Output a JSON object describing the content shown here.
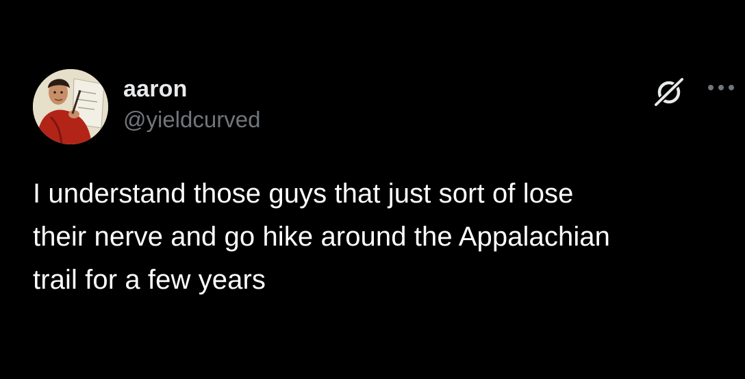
{
  "tweet": {
    "author": {
      "display_name": "aaron",
      "handle": "@yieldcurved"
    },
    "text": "I understand those guys that just sort of lose\ntheir nerve and go hike around the Appalachian\ntrail for a few years",
    "icons": {
      "avatar": "profile-photo",
      "grok": "grok-icon",
      "more": "more-options-icon"
    }
  },
  "colors": {
    "background": "#000000",
    "primary_text": "#e7e9ea",
    "secondary_text": "#71767b"
  }
}
